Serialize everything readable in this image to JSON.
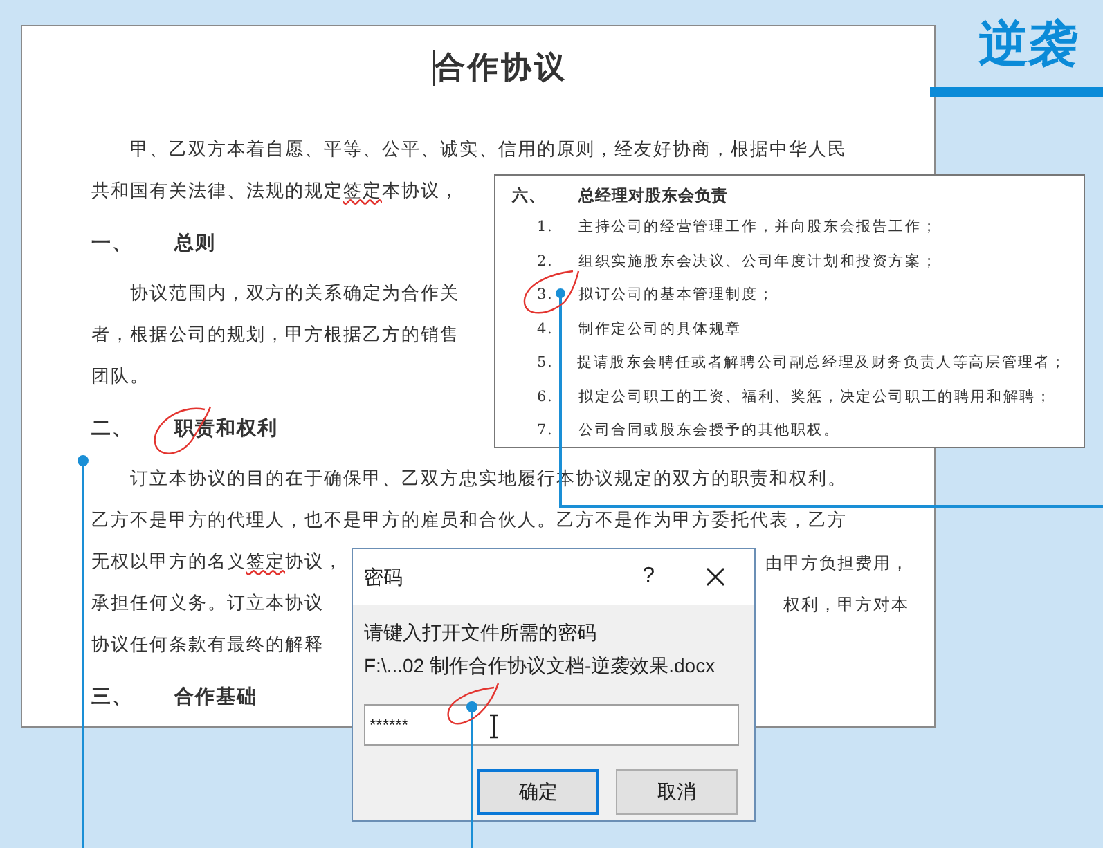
{
  "banner": {
    "title": "逆袭"
  },
  "document": {
    "title": "合作协议",
    "blocks": [
      {
        "kind": "line",
        "indent": true,
        "segments": [
          {
            "text": "甲、乙双方本着自愿、平等、公平、诚实、信用的原则，经友好协商，根据中华人民",
            "misspelled": false
          }
        ]
      },
      {
        "kind": "line",
        "indent": false,
        "segments": [
          {
            "text": "共和国有关法律、法规的规定",
            "misspelled": false
          },
          {
            "text": "签定",
            "misspelled": true
          },
          {
            "text": "本协议，",
            "misspelled": false
          }
        ]
      },
      {
        "kind": "heading",
        "number": "一、",
        "text": "总则"
      },
      {
        "kind": "line",
        "indent": true,
        "segments": [
          {
            "text": "协议范围内，双方的关系确定为合作关",
            "misspelled": false
          }
        ]
      },
      {
        "kind": "line",
        "indent": false,
        "segments": [
          {
            "text": "者，根据公司的规划，甲方根据乙方的销售",
            "misspelled": false
          }
        ]
      },
      {
        "kind": "line",
        "indent": false,
        "segments": [
          {
            "text": "团队。",
            "misspelled": false
          }
        ]
      },
      {
        "kind": "heading",
        "number": "二、",
        "text": "职责和权利"
      },
      {
        "kind": "line",
        "indent": true,
        "segments": [
          {
            "text": "订立本协议的目的在于确保甲、乙双方忠实地履行本协议规定的双方的职责和权利。",
            "misspelled": false
          }
        ]
      },
      {
        "kind": "line",
        "indent": false,
        "segments": [
          {
            "text": "乙方不是甲方的代理人，也不是甲方的雇员和合伙人。乙方不是作为甲方委托代表，乙方",
            "misspelled": false
          }
        ]
      },
      {
        "kind": "line",
        "indent": false,
        "segments": [
          {
            "text": "无权以甲方的名义",
            "misspelled": false
          },
          {
            "text": "签定",
            "misspelled": true
          },
          {
            "text": "协议，",
            "misspelled": false
          }
        ],
        "tail": "由甲方负担费用，"
      },
      {
        "kind": "line",
        "indent": false,
        "segments": [
          {
            "text": "承担任何义务。订立本协议",
            "misspelled": false
          }
        ],
        "tail": "权利，甲方对本"
      },
      {
        "kind": "line",
        "indent": false,
        "segments": [
          {
            "text": "协议任何条款有最终的解释",
            "misspelled": false
          }
        ]
      },
      {
        "kind": "heading",
        "number": "三、",
        "text": "合作基础"
      }
    ]
  },
  "excerpt": {
    "number": "六、",
    "heading": "总经理对股东会负责",
    "items": [
      {
        "number": "1.",
        "text": "主持公司的经营管理工作，并向股东会报告工作；"
      },
      {
        "number": "2.",
        "text": "组织实施股东会决议、公司年度计划和投资方案；"
      },
      {
        "number": "3.",
        "text": "拟订公司的基本管理制度；"
      },
      {
        "number": "4.",
        "text": "制作定公司的具体规章"
      },
      {
        "number": "5.",
        "text": "提请股东会聘任或者解聘公司副总经理及财务负责人等高层管理者；"
      },
      {
        "number": "6.",
        "text": "拟定公司职工的工资、福利、奖惩，决定公司职工的聘用和解聘；"
      },
      {
        "number": "7.",
        "text": "公司合同或股东会授予的其他职权。"
      }
    ]
  },
  "dialog": {
    "title": "密码",
    "help": "?",
    "prompt": "请键入打开文件所需的密码",
    "path": "F:\\...02 制作合作协议文档-逆袭效果.docx",
    "password": "******",
    "buttons": [
      {
        "label": "确定",
        "default": true
      },
      {
        "label": "取消",
        "default": false
      }
    ]
  }
}
